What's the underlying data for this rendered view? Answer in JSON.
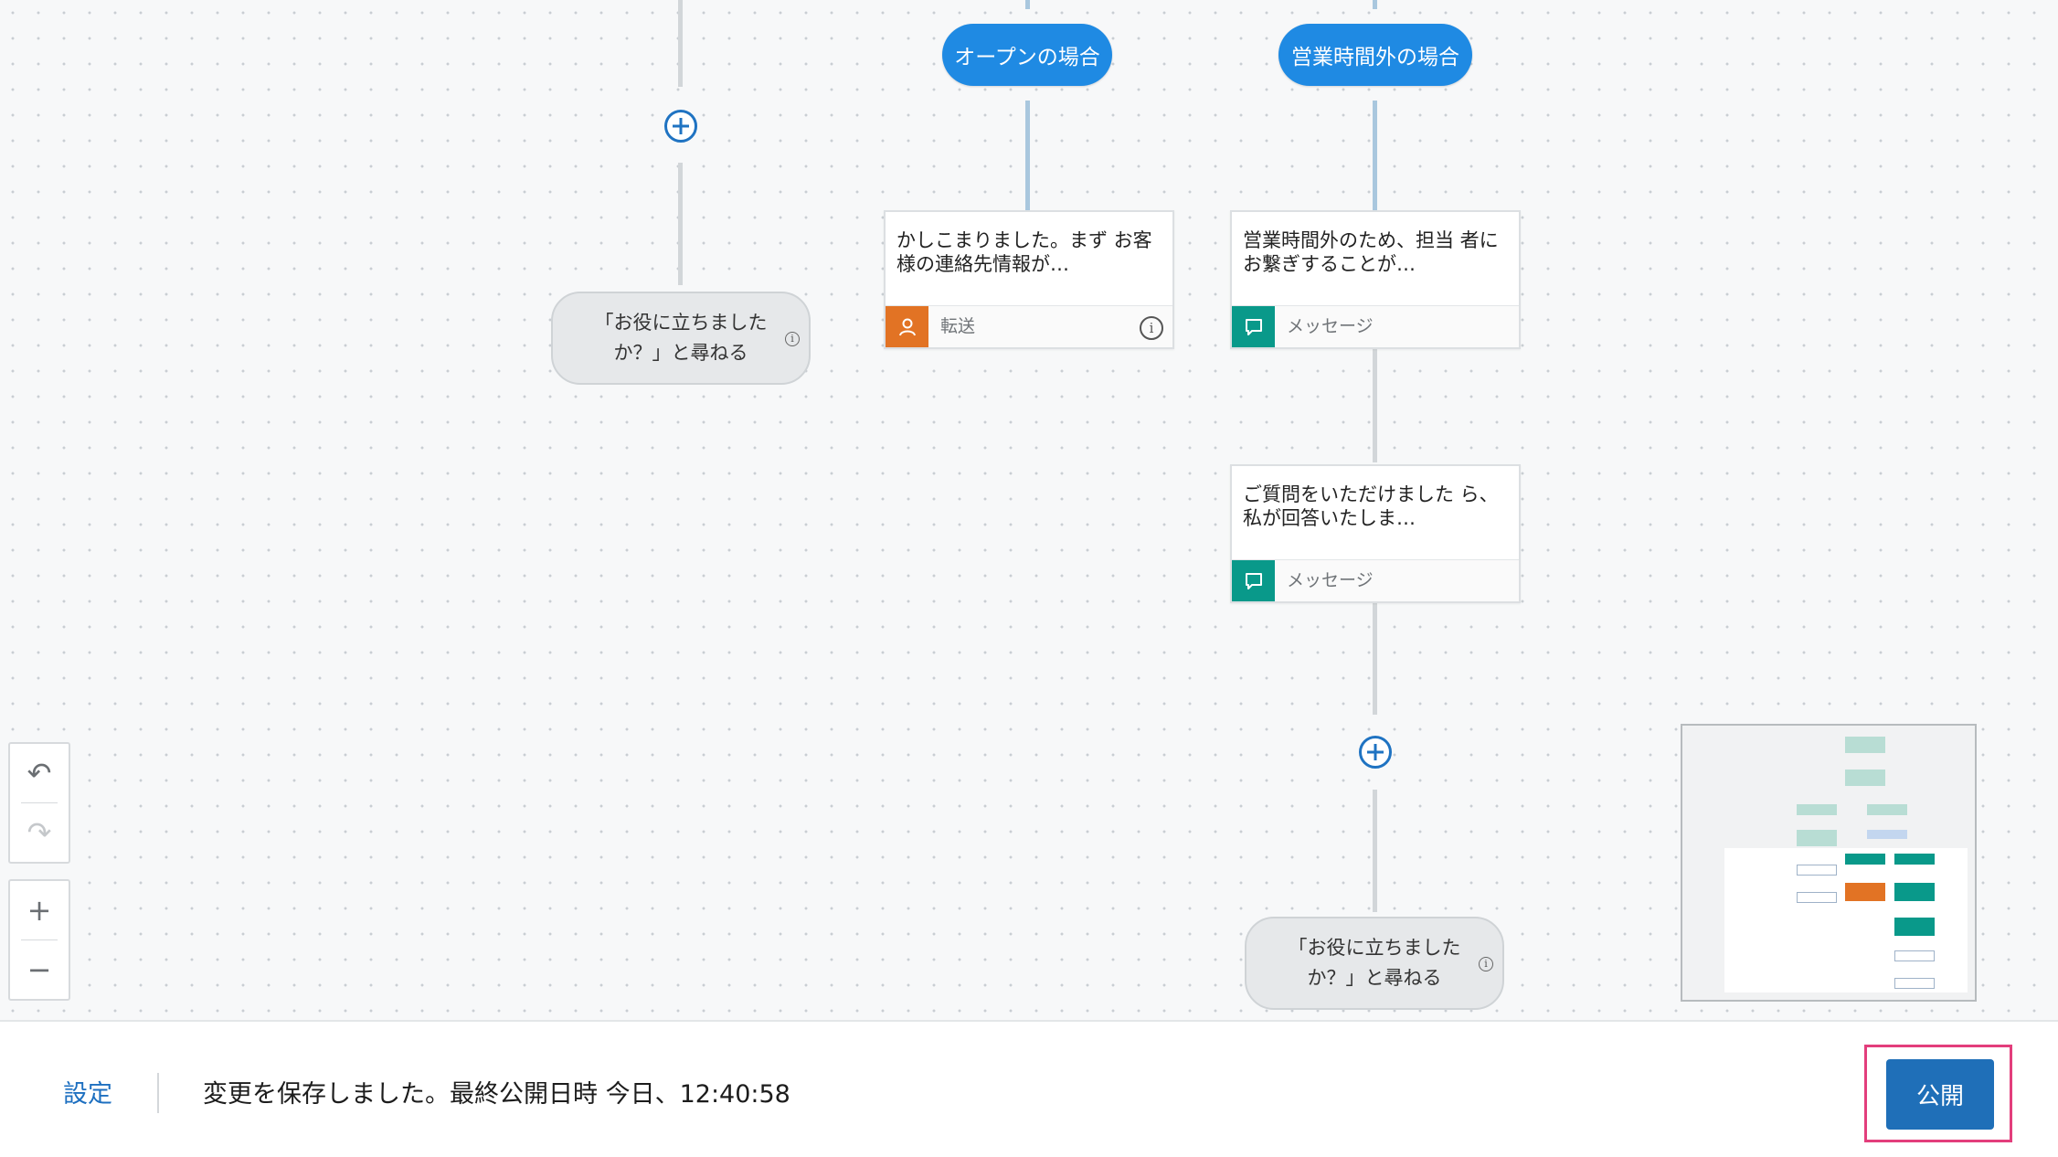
{
  "canvas": {
    "branch_open_label": "オープンの場合",
    "branch_after_hours_label": "営業時間外の場合",
    "ask_node_left_text": "「お役に立ちました か？」と尋ねる",
    "ask_node_right_text": "「お役に立ちました か？」と尋ねる",
    "info_glyph": "i",
    "card_transfer": {
      "text": "かしこまりました。まず お客様の連絡先情報が…",
      "type_label": "転送",
      "type_icon": "person-icon",
      "color": "#e27324"
    },
    "card_message_1": {
      "text": "営業時間外のため、担当 者にお繋ぎすることが…",
      "type_label": "メッセージ",
      "type_icon": "chat-bubble-icon",
      "color": "#09998a"
    },
    "card_message_2": {
      "text": "ご質問をいただけました ら、私が回答いたしま…",
      "type_label": "メッセージ",
      "type_icon": "chat-bubble-icon",
      "color": "#09998a"
    },
    "add_step_icon": "plus-circle-icon"
  },
  "toolbar": {
    "undo": "↶",
    "redo": "↷",
    "zoom_in": "+",
    "zoom_out": "−"
  },
  "footer": {
    "settings_label": "設定",
    "status_text": "変更を保存しました。最終公開日時 今日、12:40:58",
    "publish_label": "公開"
  },
  "colors": {
    "accent": "#1f8ae3",
    "publish": "#1f6fb8",
    "highlight": "#e33e7c"
  }
}
